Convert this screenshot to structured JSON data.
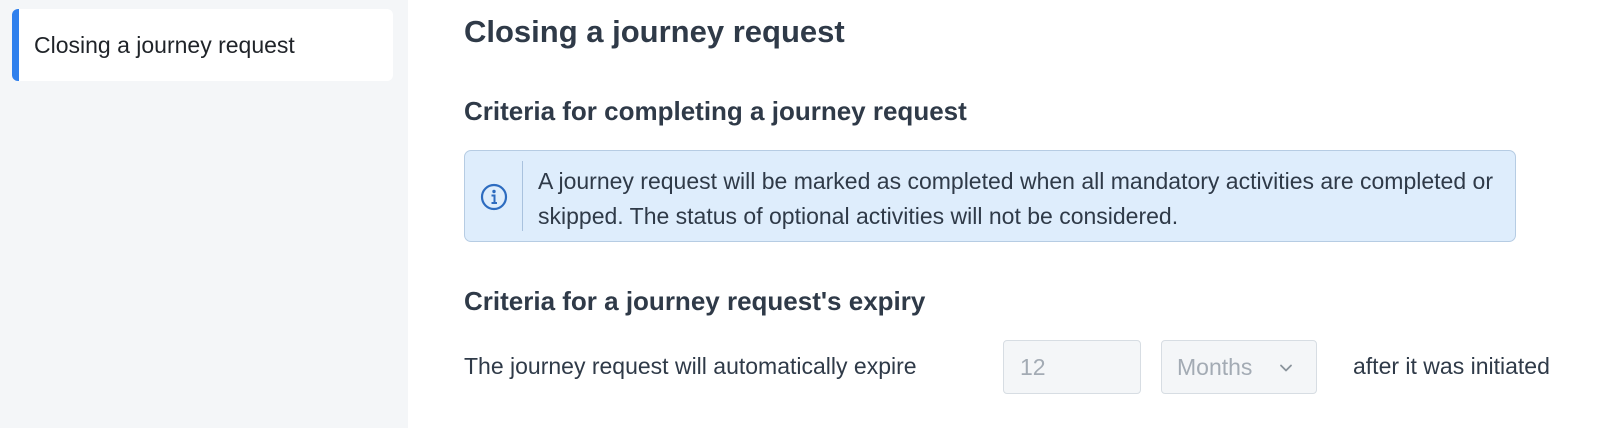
{
  "sidebar": {
    "items": [
      {
        "label": "Closing a journey request",
        "active": true
      }
    ]
  },
  "main": {
    "title": "Closing a journey request",
    "completion_section": {
      "heading": "Criteria for completing a journey request",
      "info": {
        "icon": "info-icon",
        "text": "A journey request will be marked as completed when all mandatory activities are completed or skipped. The status of optional activities will not be considered."
      }
    },
    "expiry_section": {
      "heading": "Criteria for a journey request's expiry",
      "prefix": "The journey request will automatically expire",
      "duration_placeholder": "12",
      "unit": {
        "selected": "Months",
        "icon": "chevron-down-icon"
      },
      "suffix": "after it was initiated"
    }
  },
  "colors": {
    "accent": "#2f80ed",
    "info_background": "#deedfc",
    "info_border": "#b6cce3",
    "sidebar_background": "#f4f6f8",
    "heading_text": "#2f3a48",
    "placeholder_text": "#a3abb4"
  }
}
